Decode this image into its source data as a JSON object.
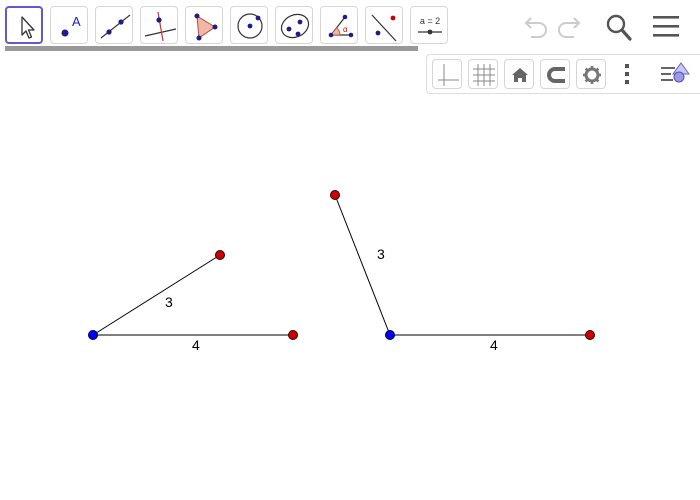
{
  "toolbar": {
    "tools": [
      {
        "name": "move-tool",
        "icon": "cursor-arrow-icon",
        "active": true
      },
      {
        "name": "point-tool",
        "icon": "point-icon",
        "label": "A"
      },
      {
        "name": "line-tool",
        "icon": "line-through-points-icon"
      },
      {
        "name": "perpendicular-tool",
        "icon": "perpendicular-line-icon"
      },
      {
        "name": "polygon-tool",
        "icon": "polygon-icon"
      },
      {
        "name": "circle-tool",
        "icon": "circle-center-point-icon"
      },
      {
        "name": "conic-tool",
        "icon": "ellipse-icon"
      },
      {
        "name": "angle-tool",
        "icon": "angle-icon",
        "label": "α"
      },
      {
        "name": "reflect-tool",
        "icon": "reflect-about-line-icon"
      },
      {
        "name": "slider-tool",
        "icon": "slider-icon",
        "label": "a = 2"
      }
    ],
    "right": [
      {
        "name": "undo-button",
        "icon": "undo-icon",
        "enabled": false
      },
      {
        "name": "redo-button",
        "icon": "redo-icon",
        "enabled": false
      },
      {
        "name": "search-button",
        "icon": "search-icon"
      },
      {
        "name": "menu-button",
        "icon": "hamburger-menu-icon"
      }
    ]
  },
  "style_bar": {
    "buttons": [
      {
        "name": "axes-toggle",
        "icon": "axes-icon"
      },
      {
        "name": "grid-toggle",
        "icon": "grid-icon"
      },
      {
        "name": "standard-view",
        "icon": "home-icon"
      },
      {
        "name": "point-capturing",
        "icon": "magnet-icon"
      },
      {
        "name": "graphics-settings",
        "icon": "gear-icon"
      },
      {
        "name": "more-options",
        "icon": "vertical-dots-icon"
      },
      {
        "name": "toggle-style-bar",
        "icon": "style-bar-icon"
      }
    ]
  },
  "drawing": {
    "colors": {
      "base_point": "#0000ff",
      "free_point": "#cc0000",
      "segment": "#000000",
      "active_tool": "#6557d2"
    },
    "segment_labels": {
      "left_slanted": "3",
      "left_horizontal": "4",
      "right_slanted": "3",
      "right_horizontal": "4"
    }
  }
}
